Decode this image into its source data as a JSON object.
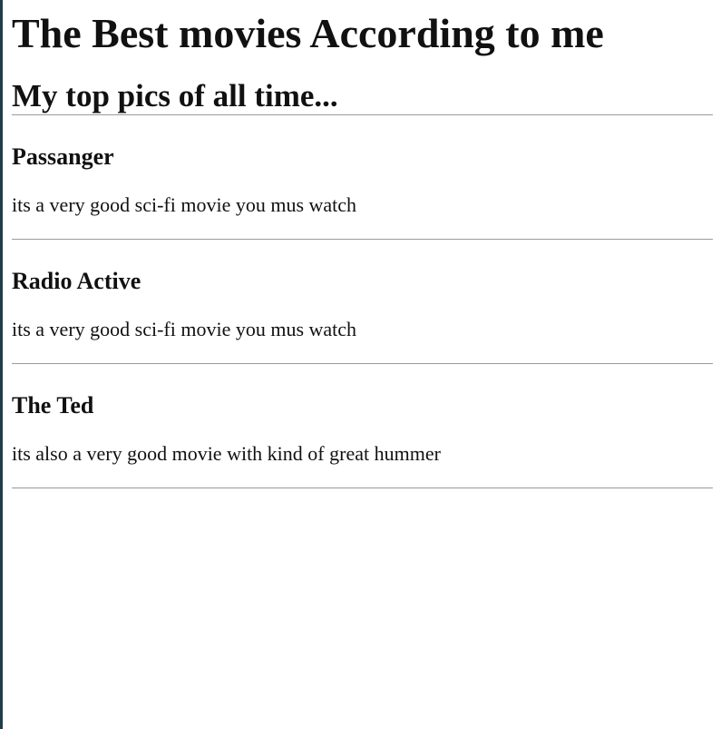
{
  "header": {
    "title": "The Best movies According to me",
    "subtitle": "My top pics of all time..."
  },
  "movies": [
    {
      "title": "Passanger",
      "description": "its a very good sci-fi movie you mus watch"
    },
    {
      "title": "Radio Active",
      "description": "its a very good sci-fi movie you mus watch"
    },
    {
      "title": "The Ted",
      "description": "its also a very good movie with kind of great hummer"
    }
  ],
  "colors": {
    "text": "#111111",
    "divider": "#9a9a9a",
    "left_border": "#1f3d4c",
    "background": "#ffffff"
  }
}
